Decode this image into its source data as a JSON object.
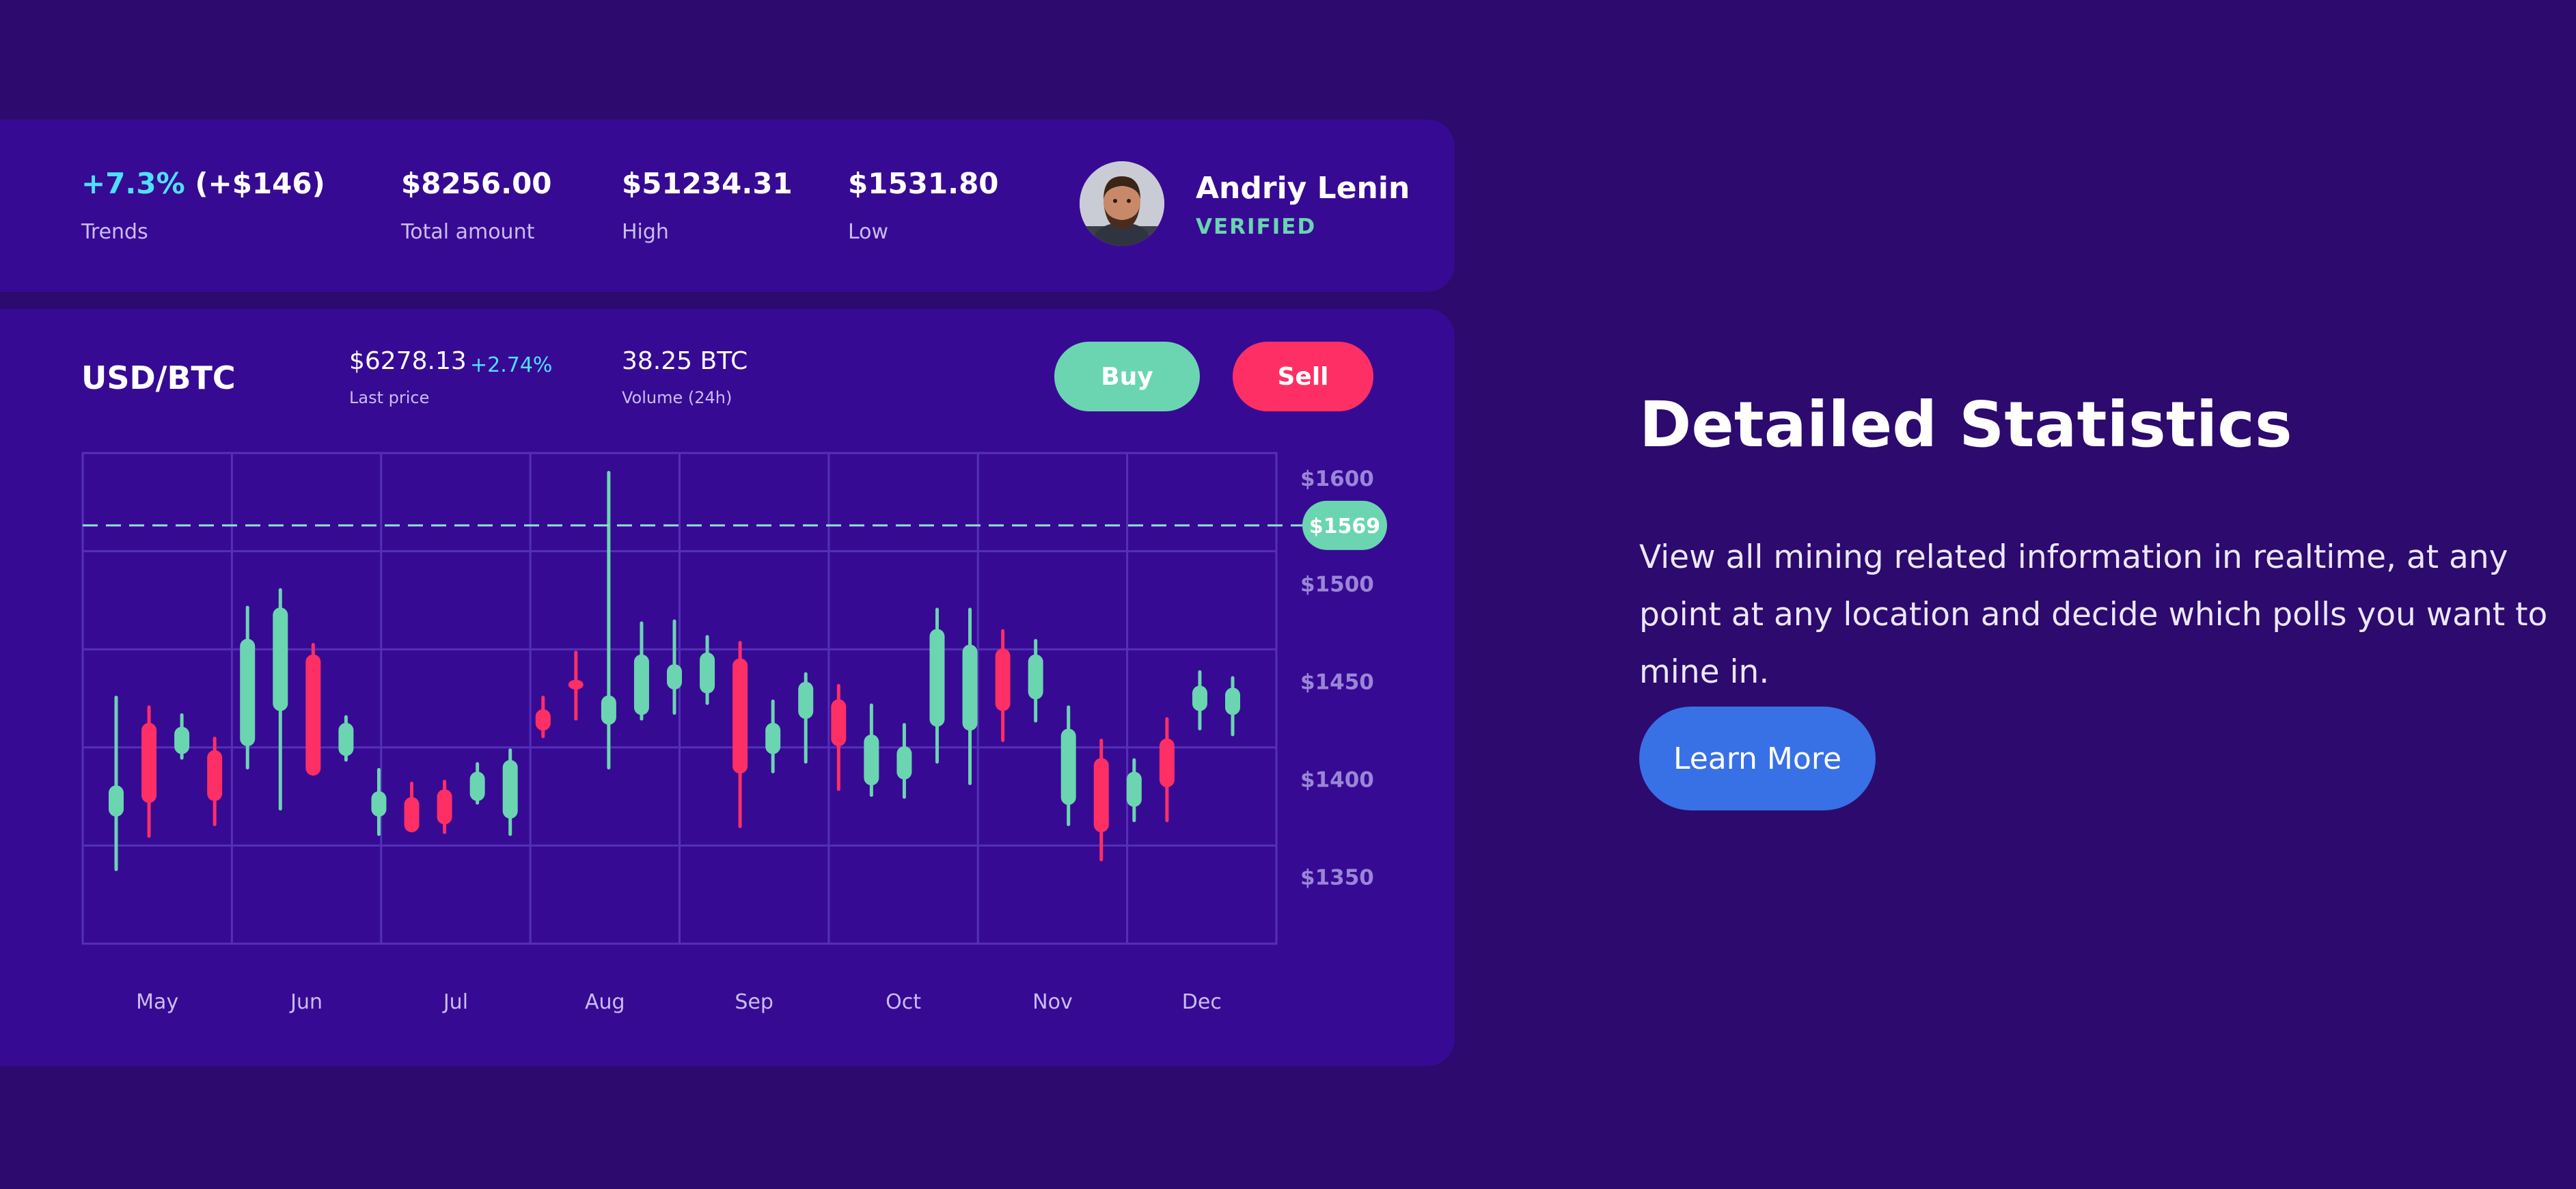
{
  "stats": {
    "trend_percent": "+7.3%",
    "trend_amount": "(+$146)",
    "trend_label": "Trends",
    "total_value": "$8256.00",
    "total_label": "Total amount",
    "high_value": "$51234.31",
    "high_label": "High",
    "low_value": "$1531.80",
    "low_label": "Low"
  },
  "user": {
    "name": "Andriy Lenin",
    "status": "VERIFIED"
  },
  "market": {
    "pair": "USD/BTC",
    "last_price": "$6278.13",
    "last_price_change": "+2.74%",
    "last_price_label": "Last price",
    "volume": "38.25 BTC",
    "volume_label": "Volume (24h)",
    "buy_label": "Buy",
    "sell_label": "Sell"
  },
  "colors": {
    "up": "#6ad5b0",
    "down": "#fe2f64",
    "accent": "#4fe0ff",
    "card": "#370a94",
    "background": "#2c0a6e"
  },
  "chart_data": {
    "type": "candlestick",
    "title": "",
    "xlabel": "",
    "ylabel": "",
    "x_ticks": [
      "May",
      "Jun",
      "Jul",
      "Aug",
      "Sep",
      "Oct",
      "Nov",
      "Dec"
    ],
    "y_ticks": [
      "$1600",
      "$1500",
      "$1450",
      "$1400",
      "$1350"
    ],
    "y_tick_values": [
      1593,
      1539,
      1489,
      1439,
      1389
    ],
    "ylim": [
      1355,
      1606
    ],
    "current_price": 1569,
    "current_price_label": "$1569",
    "grid": true,
    "candles": [
      {
        "low": 1393,
        "high": 1481,
        "open": 1420,
        "close": 1436,
        "dir": "up"
      },
      {
        "low": 1410,
        "high": 1476,
        "open": 1468,
        "close": 1427,
        "dir": "down"
      },
      {
        "low": 1450,
        "high": 1472,
        "open": 1452,
        "close": 1466,
        "dir": "up"
      },
      {
        "low": 1416,
        "high": 1460,
        "open": 1454,
        "close": 1428,
        "dir": "down"
      },
      {
        "low": 1445,
        "high": 1527,
        "open": 1456,
        "close": 1511,
        "dir": "up"
      },
      {
        "low": 1424,
        "high": 1536,
        "open": 1474,
        "close": 1527,
        "dir": "up"
      },
      {
        "low": 1452,
        "high": 1508,
        "open": 1503,
        "close": 1441,
        "dir": "down"
      },
      {
        "low": 1449,
        "high": 1471,
        "open": 1451,
        "close": 1468,
        "dir": "up"
      },
      {
        "low": 1411,
        "high": 1444,
        "open": 1420,
        "close": 1433,
        "dir": "up"
      },
      {
        "low": 1419,
        "high": 1437,
        "open": 1430,
        "close": 1412,
        "dir": "down"
      },
      {
        "low": 1412,
        "high": 1438,
        "open": 1434,
        "close": 1416,
        "dir": "down"
      },
      {
        "low": 1427,
        "high": 1447,
        "open": 1428,
        "close": 1443,
        "dir": "up"
      },
      {
        "low": 1411,
        "high": 1454,
        "open": 1419,
        "close": 1449,
        "dir": "up"
      },
      {
        "low": 1461,
        "high": 1481,
        "open": 1475,
        "close": 1464,
        "dir": "down"
      },
      {
        "low": 1470,
        "high": 1504,
        "open": 1485,
        "close": 1490,
        "dir": "down"
      },
      {
        "low": 1445,
        "high": 1596,
        "open": 1467,
        "close": 1482,
        "dir": "up"
      },
      {
        "low": 1470,
        "high": 1519,
        "open": 1472,
        "close": 1503,
        "dir": "up"
      },
      {
        "low": 1473,
        "high": 1520,
        "open": 1485,
        "close": 1498,
        "dir": "up"
      },
      {
        "low": 1478,
        "high": 1512,
        "open": 1483,
        "close": 1504,
        "dir": "up"
      },
      {
        "low": 1415,
        "high": 1509,
        "open": 1501,
        "close": 1442,
        "dir": "down"
      },
      {
        "low": 1443,
        "high": 1479,
        "open": 1452,
        "close": 1468,
        "dir": "up"
      },
      {
        "low": 1448,
        "high": 1493,
        "open": 1470,
        "close": 1489,
        "dir": "up"
      },
      {
        "low": 1434,
        "high": 1487,
        "open": 1480,
        "close": 1456,
        "dir": "down"
      },
      {
        "low": 1431,
        "high": 1477,
        "open": 1436,
        "close": 1462,
        "dir": "up"
      },
      {
        "low": 1430,
        "high": 1467,
        "open": 1439,
        "close": 1456,
        "dir": "up"
      },
      {
        "low": 1448,
        "high": 1526,
        "open": 1466,
        "close": 1516,
        "dir": "up"
      },
      {
        "low": 1437,
        "high": 1526,
        "open": 1464,
        "close": 1508,
        "dir": "up"
      },
      {
        "low": 1459,
        "high": 1515,
        "open": 1506,
        "close": 1474,
        "dir": "down"
      },
      {
        "low": 1469,
        "high": 1510,
        "open": 1480,
        "close": 1503,
        "dir": "up"
      },
      {
        "low": 1416,
        "high": 1476,
        "open": 1426,
        "close": 1465,
        "dir": "up"
      },
      {
        "low": 1398,
        "high": 1459,
        "open": 1450,
        "close": 1412,
        "dir": "down"
      },
      {
        "low": 1418,
        "high": 1449,
        "open": 1425,
        "close": 1443,
        "dir": "up"
      },
      {
        "low": 1418,
        "high": 1470,
        "open": 1460,
        "close": 1435,
        "dir": "down"
      },
      {
        "low": 1465,
        "high": 1494,
        "open": 1474,
        "close": 1487,
        "dir": "up"
      },
      {
        "low": 1462,
        "high": 1491,
        "open": 1472,
        "close": 1486,
        "dir": "up"
      }
    ]
  },
  "feature": {
    "title": "Detailed Statistics",
    "description": "View all mining related information in realtime, at any point at any location and decide which polls you want to mine in.",
    "cta_label": "Learn More"
  }
}
